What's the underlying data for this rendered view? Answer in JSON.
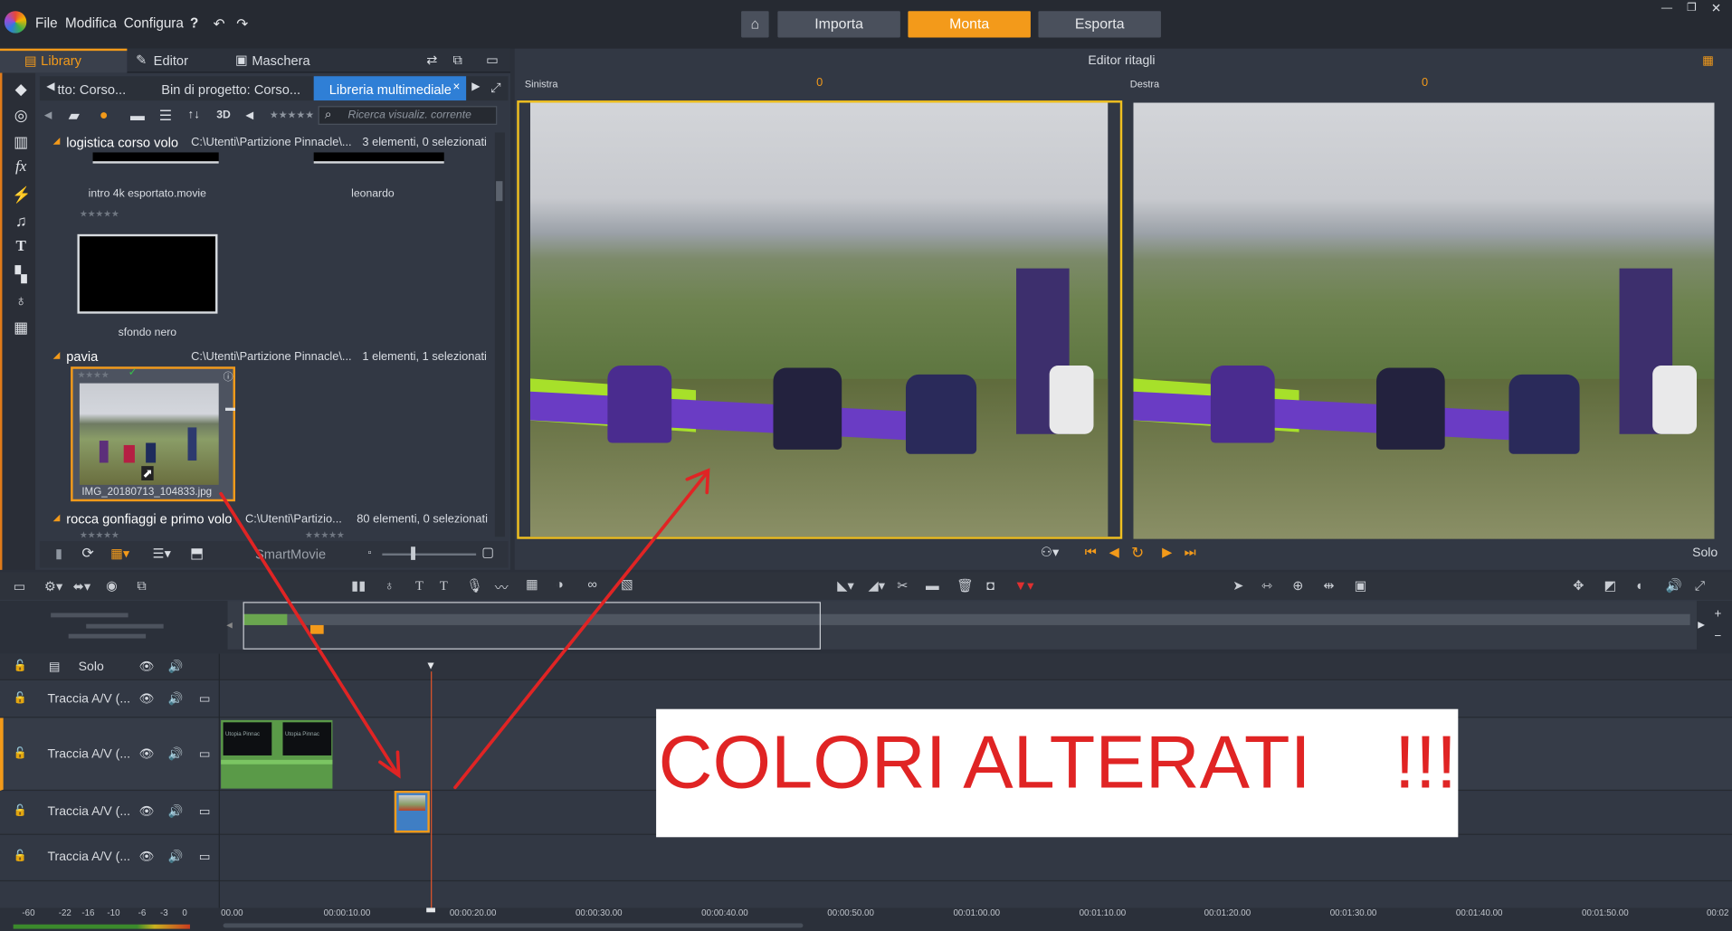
{
  "menu": {
    "file": "File",
    "edit": "Modifica",
    "config": "Configura"
  },
  "nav_tabs": {
    "import": "Importa",
    "edit": "Monta",
    "export": "Esporta"
  },
  "left_tabs": {
    "library": "Library",
    "editor": "Editor",
    "mask": "Maschera"
  },
  "lib_tabs": [
    "tto: Corso...",
    "Bin di progetto: Corso...",
    "Libreria multimediale"
  ],
  "search_placeholder": "Ricerca visualiz. corrente",
  "toolbar_3d": "3D",
  "groups": [
    {
      "name": "logistica corso volo",
      "path": "C:\\Utenti\\Partizione Pinnacle\\...",
      "count": "3 elementi, 0 selezionati"
    },
    {
      "name": "pavia",
      "path": "C:\\Utenti\\Partizione Pinnacle\\...",
      "count": "1 elementi, 1 selezionati"
    },
    {
      "name": "rocca gonfiaggi e primo volo",
      "path": "C:\\Utenti\\Partizio...",
      "count": "80 elementi, 0 selezionati"
    }
  ],
  "items": {
    "intro": "intro 4k esportato.movie",
    "leonardo": "leonardo",
    "sfondo": "sfondo nero",
    "img": "IMG_20180713_104833.jpg"
  },
  "smartmovie": "SmartMovie",
  "editor": {
    "title": "Editor ritagli",
    "left_label": "Sinistra",
    "left_value": "0",
    "right_label": "Destra",
    "right_value": "0",
    "solo": "Solo"
  },
  "tracks": [
    {
      "label": "Solo"
    },
    {
      "label": "Traccia A/V (..."
    },
    {
      "label": "Traccia A/V (..."
    },
    {
      "label": "Traccia A/V (..."
    },
    {
      "label": "Traccia A/V (..."
    }
  ],
  "clip_titles": [
    "Utopia Pinnac",
    "Utopia Pinnac"
  ],
  "ruler": [
    "00.00",
    "00:00:10.00",
    "00:00:20.00",
    "00:00:30.00",
    "00:00:40.00",
    "00:00:50.00",
    "00:01:00.00",
    "00:01:10.00",
    "00:01:20.00",
    "00:01:30.00",
    "00:01:40.00",
    "00:01:50.00",
    "00:02"
  ],
  "meter": [
    "-60",
    "-22",
    "-16",
    "-10",
    "-6",
    "-3",
    "0"
  ],
  "annotation": "COLORI ALTERATI    !!!",
  "colors": {
    "accent": "#f39a1a",
    "selected_tab": "#2f7fd6",
    "annotation": "#e02424"
  }
}
